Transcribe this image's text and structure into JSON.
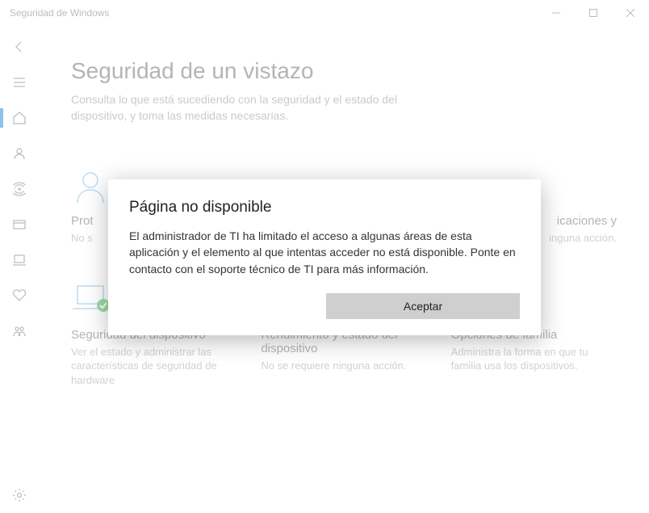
{
  "window": {
    "title": "Seguridad de Windows"
  },
  "header": {
    "title": "Seguridad de un vistazo",
    "subtitle": "Consulta lo que está sucediendo con la seguridad y el estado del dispositivo, y toma las medidas necesarias."
  },
  "tiles": {
    "t0_title": "Prot",
    "t0_desc": "No s",
    "t1_title": "icaciones y",
    "t1_desc": "inguna acción.",
    "t2_title": "Seguridad del dispositivo",
    "t2_desc": "Ver el estado y administrar las características de seguridad de hardware",
    "t3_title": "Rendimiento y estado del dispositivo",
    "t3_desc": "No se requiere ninguna acción.",
    "t4_title": "Opciones de familia",
    "t4_desc": "Administra la forma en que tu familia usa los dispositivos."
  },
  "dialog": {
    "title": "Página no disponible",
    "body": "El administrador de TI ha limitado el acceso a algunas áreas de esta aplicación y el elemento al que intentas acceder no está disponible. Ponte en contacto con el soporte técnico de TI para más información.",
    "ok": "Aceptar"
  }
}
